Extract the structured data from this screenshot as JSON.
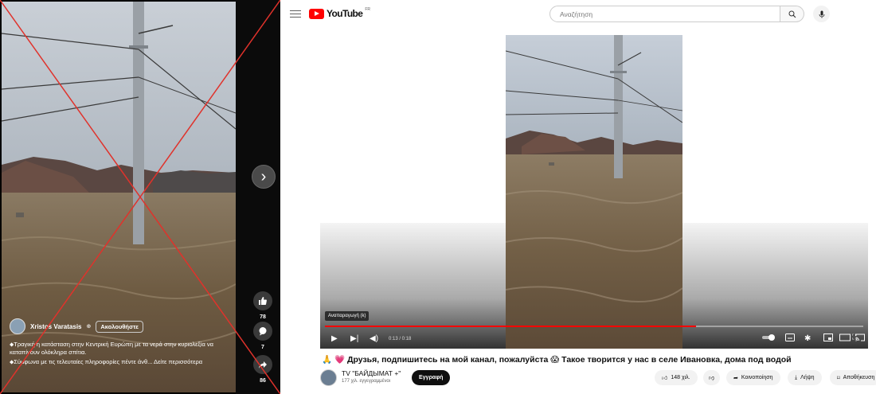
{
  "facebook": {
    "author_name": "Xristos Varatasis",
    "follow_label": "Ακολουθήστε",
    "caption_line1": "⬥Τραγική η κατάσταση στην Κεντρική Ευρώπη με τα νερά  στην κυριολεξία να καταπίνουν ολόκληρα σπίτια.",
    "caption_line2": "⬥Σύμφωνα με τις τελευταίες πληροφορίες πέντε άνθ... Δείτε περισσότερα",
    "likes": "78",
    "comments": "7",
    "shares": "86",
    "next_icon": "chevron-right-icon",
    "crossed_out_color": "#e0322b"
  },
  "youtube": {
    "logo_text": "YouTube",
    "region_code": "FR",
    "search_placeholder": "Αναζήτηση",
    "player": {
      "tooltip": "Αναπαραγωγή (k)",
      "time": "0:13 / 0:18",
      "progress": 0.69
    },
    "video_title": "🙏 💗 Друзья, подпишитесь на мой канал, пожалуйста 😱 Такое творится у нас в селе Ивановка, дома под водой",
    "channel_name": "TV \"БАЙДЫМАТ +\"",
    "subscribers": "177 χιλ. εγγεγραμμένοι",
    "subscribe_label": "Εγγραφή",
    "likes": "148 χιλ.",
    "share_label": "Κοινοποίηση",
    "download_label": "Λήψη",
    "save_label": "Αποθήκευση"
  }
}
